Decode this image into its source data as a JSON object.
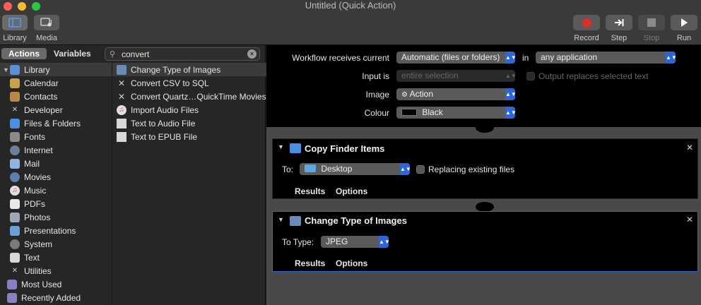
{
  "window": {
    "title": "Untitled (Quick Action)"
  },
  "toolbar": {
    "library_label": "Library",
    "media_label": "Media",
    "record_label": "Record",
    "step_label": "Step",
    "stop_label": "Stop",
    "run_label": "Run"
  },
  "left_panel": {
    "tabs": [
      "Actions",
      "Variables"
    ],
    "search": {
      "value": "convert"
    },
    "categories": [
      {
        "label": "Library",
        "icon": "library-icon"
      },
      {
        "label": "Calendar",
        "icon": "calendar-icon"
      },
      {
        "label": "Contacts",
        "icon": "contacts-icon"
      },
      {
        "label": "Developer",
        "icon": "developer-icon"
      },
      {
        "label": "Files & Folders",
        "icon": "finder-icon"
      },
      {
        "label": "Fonts",
        "icon": "fonts-icon"
      },
      {
        "label": "Internet",
        "icon": "globe-icon"
      },
      {
        "label": "Mail",
        "icon": "mail-icon"
      },
      {
        "label": "Movies",
        "icon": "movies-icon"
      },
      {
        "label": "Music",
        "icon": "music-icon"
      },
      {
        "label": "PDFs",
        "icon": "pdf-icon"
      },
      {
        "label": "Photos",
        "icon": "photos-icon"
      },
      {
        "label": "Presentations",
        "icon": "presentations-icon"
      },
      {
        "label": "System",
        "icon": "system-icon"
      },
      {
        "label": "Text",
        "icon": "text-icon"
      },
      {
        "label": "Utilities",
        "icon": "utilities-icon"
      },
      {
        "label": "Most Used",
        "icon": "smart-folder-icon"
      },
      {
        "label": "Recently Added",
        "icon": "smart-folder-icon"
      }
    ],
    "actions": [
      {
        "label": "Change Type of Images",
        "icon": "preview-icon"
      },
      {
        "label": "Convert CSV to SQL",
        "icon": "tools-icon"
      },
      {
        "label": "Convert Quartz…QuickTime Movies",
        "icon": "tools-icon"
      },
      {
        "label": "Import Audio Files",
        "icon": "music-icon"
      },
      {
        "label": "Text to Audio File",
        "icon": "text-icon"
      },
      {
        "label": "Text to EPUB File",
        "icon": "text-icon"
      }
    ]
  },
  "workflow_header": {
    "receives_label": "Workflow receives current",
    "receives_value": "Automatic (files or folders)",
    "in_label": "in",
    "app_value": "any application",
    "input_label": "Input is",
    "input_value": "entire selection",
    "output_replaces_label": "Output replaces selected text",
    "image_label": "Image",
    "image_value": "Action",
    "colour_label": "Colour",
    "colour_value": "Black"
  },
  "cards": {
    "copy_finder": {
      "title": "Copy Finder Items",
      "to_label": "To:",
      "to_value": "Desktop",
      "replacing_label": "Replacing existing files",
      "results_label": "Results",
      "options_label": "Options"
    },
    "change_type": {
      "title": "Change Type of Images",
      "to_type_label": "To Type:",
      "to_type_value": "JPEG",
      "results_label": "Results",
      "options_label": "Options"
    }
  },
  "colors": {
    "accent": "#2e66d8",
    "record": "#d9302b"
  }
}
